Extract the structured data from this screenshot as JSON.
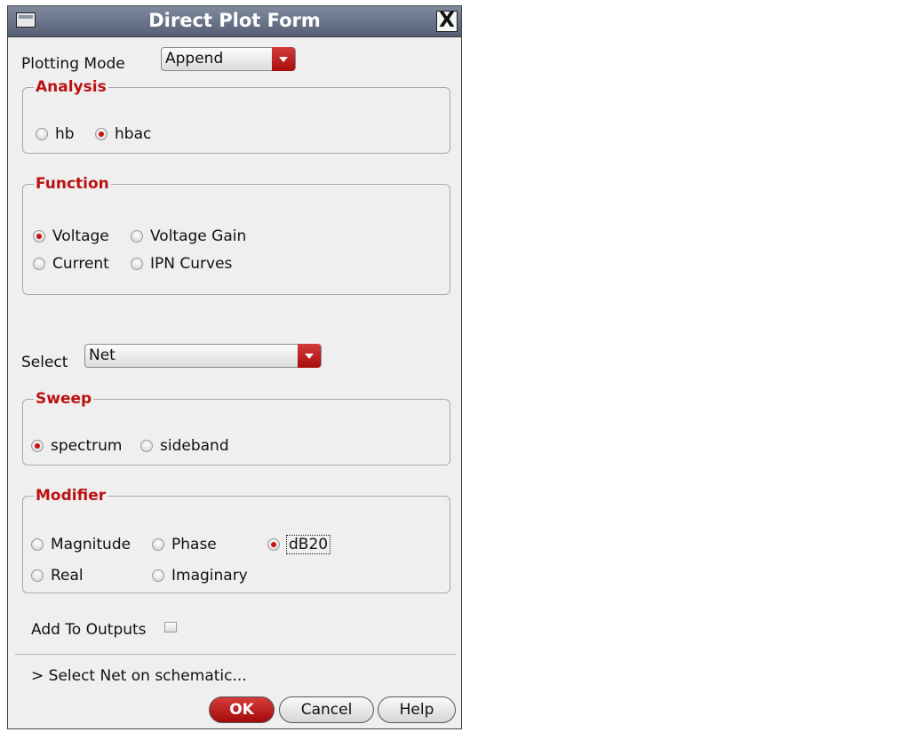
{
  "window": {
    "title": "Direct Plot Form",
    "close_glyph": "X"
  },
  "plotting_mode": {
    "label": "Plotting Mode",
    "value": "Append"
  },
  "analysis": {
    "legend": "Analysis",
    "options": [
      "hb",
      "hbac"
    ],
    "selected": "hbac"
  },
  "function": {
    "legend": "Function",
    "options": [
      "Voltage",
      "Voltage Gain",
      "Current",
      "IPN Curves"
    ],
    "selected": "Voltage"
  },
  "select": {
    "label": "Select",
    "value": "Net"
  },
  "sweep": {
    "legend": "Sweep",
    "options": [
      "spectrum",
      "sideband"
    ],
    "selected": "spectrum"
  },
  "modifier": {
    "legend": "Modifier",
    "options": [
      "Magnitude",
      "Phase",
      "dB20",
      "Real",
      "Imaginary"
    ],
    "selected": "dB20"
  },
  "add_to_outputs": {
    "label": "Add To Outputs",
    "checked": false
  },
  "status": {
    "text": "> Select Net on schematic..."
  },
  "buttons": {
    "ok": "OK",
    "cancel": "Cancel",
    "help": "Help"
  },
  "colors": {
    "accent_red": "#bb1111",
    "titlebar": "#555f75",
    "background": "#efefef"
  },
  "icons": {
    "window_menu": "window-menu-icon",
    "close": "close-icon",
    "dropdown": "chevron-down-icon"
  }
}
